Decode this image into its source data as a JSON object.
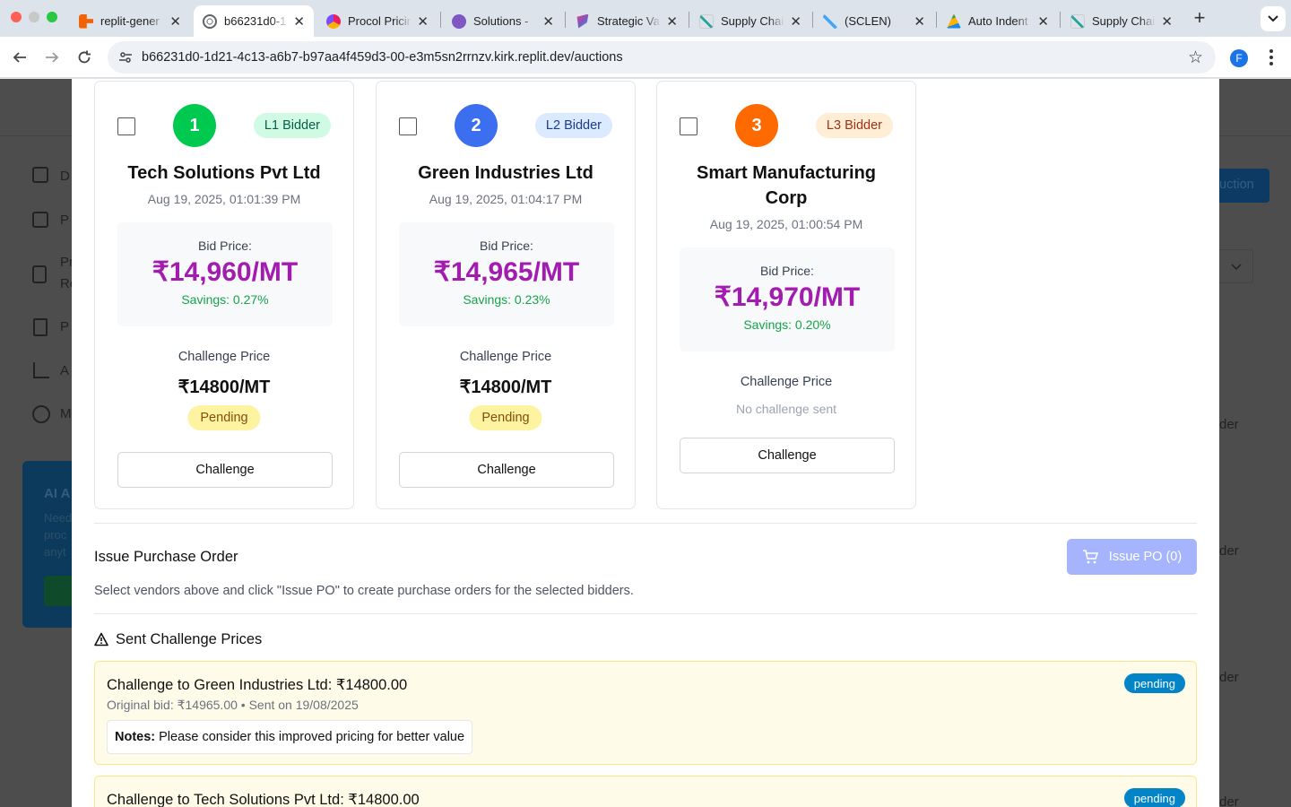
{
  "browser": {
    "tabs": [
      {
        "label": "replit-gener",
        "icon": "replit-icon",
        "color": "#f26207"
      },
      {
        "label": "b66231d0-1",
        "icon": "globe-icon",
        "color": "#5f6368",
        "active": true
      },
      {
        "label": "Procol Pricin",
        "icon": "procol-icon",
        "color": "#e91e63"
      },
      {
        "label": "Solutions - ",
        "icon": "solutions-icon",
        "color": "#7e57c2"
      },
      {
        "label": "Strategic Va",
        "icon": "strategic-icon",
        "color": "#ab47bc"
      },
      {
        "label": "Supply Chai",
        "icon": "supply-icon",
        "color": "#26a69a"
      },
      {
        "label": "(SCLEN)",
        "icon": "sclen-icon",
        "color": "#26a69a"
      },
      {
        "label": "Auto Indent",
        "icon": "auto-indent-icon",
        "color": "#43a047"
      },
      {
        "label": "Supply Chai",
        "icon": "supply-icon",
        "color": "#26a69a"
      }
    ],
    "url": "b66231d0-1d21-4c13-a6b7-b97aa4f459d3-00-e3m5sn2rrnzv.kirk.replit.dev/auctions",
    "profile_initial": "F"
  },
  "background": {
    "sidebar_fragments": [
      "D",
      "P",
      "Pr",
      "Re",
      "P",
      "A",
      "M"
    ],
    "ai_title": "AI A",
    "ai_lines": [
      "Need",
      "proc",
      "anyt"
    ],
    "header_btn": "uction",
    "row_labels": [
      "der",
      "der",
      "der",
      "der"
    ]
  },
  "bids": [
    {
      "rank": "1",
      "badge": "L1 Bidder",
      "vendor": "Tech Solutions Pvt Ltd",
      "date": "Aug 19, 2025, 01:01:39 PM",
      "bid_label": "Bid Price:",
      "bid_price": "₹14,960/MT",
      "savings": "Savings: 0.27%",
      "challenge_label": "Challenge Price",
      "challenge_price": "₹14800/MT",
      "status": "Pending",
      "button": "Challenge",
      "rank_color": "#00c950",
      "badge_bg": "#d1fae5",
      "badge_fg": "#065f46"
    },
    {
      "rank": "2",
      "badge": "L2 Bidder",
      "vendor": "Green Industries Ltd",
      "date": "Aug 19, 2025, 01:04:17 PM",
      "bid_label": "Bid Price:",
      "bid_price": "₹14,965/MT",
      "savings": "Savings: 0.23%",
      "challenge_label": "Challenge Price",
      "challenge_price": "₹14800/MT",
      "status": "Pending",
      "button": "Challenge",
      "rank_color": "#3b6ff0",
      "badge_bg": "#dbeafe",
      "badge_fg": "#1e3a8a"
    },
    {
      "rank": "3",
      "badge": "L3 Bidder",
      "vendor": "Smart Manufacturing Corp",
      "date": "Aug 19, 2025, 01:00:54 PM",
      "bid_label": "Bid Price:",
      "bid_price": "₹14,970/MT",
      "savings": "Savings: 0.20%",
      "challenge_label": "Challenge Price",
      "no_challenge": "No challenge sent",
      "button": "Challenge",
      "rank_color": "#ff6a00",
      "badge_bg": "#ffedd5",
      "badge_fg": "#9a3412"
    }
  ],
  "purchase_order": {
    "title": "Issue Purchase Order",
    "button": "Issue PO (0)",
    "description": "Select vendors above and click \"Issue PO\" to create purchase orders for the selected bidders."
  },
  "sent_challenges": {
    "title": "Sent Challenge Prices",
    "items": [
      {
        "title": "Challenge to Green Industries Ltd: ₹14800.00",
        "meta": "Original bid: ₹14965.00 • Sent on 19/08/2025",
        "status": "pending",
        "notes_label": "Notes:",
        "notes": "Please consider this improved pricing for better value"
      },
      {
        "title": "Challenge to Tech Solutions Pvt Ltd: ₹14800.00",
        "status": "pending"
      }
    ]
  }
}
